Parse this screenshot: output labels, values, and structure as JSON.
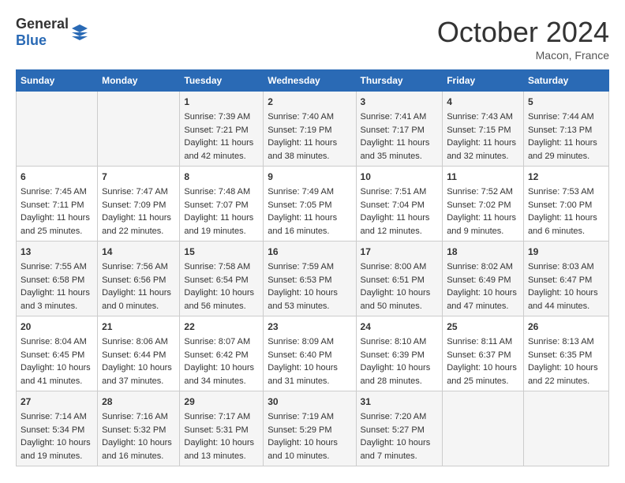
{
  "logo": {
    "general": "General",
    "blue": "Blue"
  },
  "title": "October 2024",
  "subtitle": "Macon, France",
  "headers": [
    "Sunday",
    "Monday",
    "Tuesday",
    "Wednesday",
    "Thursday",
    "Friday",
    "Saturday"
  ],
  "weeks": [
    [
      {
        "day": "",
        "sunrise": "",
        "sunset": "",
        "daylight": ""
      },
      {
        "day": "",
        "sunrise": "",
        "sunset": "",
        "daylight": ""
      },
      {
        "day": "1",
        "sunrise": "Sunrise: 7:39 AM",
        "sunset": "Sunset: 7:21 PM",
        "daylight": "Daylight: 11 hours and 42 minutes."
      },
      {
        "day": "2",
        "sunrise": "Sunrise: 7:40 AM",
        "sunset": "Sunset: 7:19 PM",
        "daylight": "Daylight: 11 hours and 38 minutes."
      },
      {
        "day": "3",
        "sunrise": "Sunrise: 7:41 AM",
        "sunset": "Sunset: 7:17 PM",
        "daylight": "Daylight: 11 hours and 35 minutes."
      },
      {
        "day": "4",
        "sunrise": "Sunrise: 7:43 AM",
        "sunset": "Sunset: 7:15 PM",
        "daylight": "Daylight: 11 hours and 32 minutes."
      },
      {
        "day": "5",
        "sunrise": "Sunrise: 7:44 AM",
        "sunset": "Sunset: 7:13 PM",
        "daylight": "Daylight: 11 hours and 29 minutes."
      }
    ],
    [
      {
        "day": "6",
        "sunrise": "Sunrise: 7:45 AM",
        "sunset": "Sunset: 7:11 PM",
        "daylight": "Daylight: 11 hours and 25 minutes."
      },
      {
        "day": "7",
        "sunrise": "Sunrise: 7:47 AM",
        "sunset": "Sunset: 7:09 PM",
        "daylight": "Daylight: 11 hours and 22 minutes."
      },
      {
        "day": "8",
        "sunrise": "Sunrise: 7:48 AM",
        "sunset": "Sunset: 7:07 PM",
        "daylight": "Daylight: 11 hours and 19 minutes."
      },
      {
        "day": "9",
        "sunrise": "Sunrise: 7:49 AM",
        "sunset": "Sunset: 7:05 PM",
        "daylight": "Daylight: 11 hours and 16 minutes."
      },
      {
        "day": "10",
        "sunrise": "Sunrise: 7:51 AM",
        "sunset": "Sunset: 7:04 PM",
        "daylight": "Daylight: 11 hours and 12 minutes."
      },
      {
        "day": "11",
        "sunrise": "Sunrise: 7:52 AM",
        "sunset": "Sunset: 7:02 PM",
        "daylight": "Daylight: 11 hours and 9 minutes."
      },
      {
        "day": "12",
        "sunrise": "Sunrise: 7:53 AM",
        "sunset": "Sunset: 7:00 PM",
        "daylight": "Daylight: 11 hours and 6 minutes."
      }
    ],
    [
      {
        "day": "13",
        "sunrise": "Sunrise: 7:55 AM",
        "sunset": "Sunset: 6:58 PM",
        "daylight": "Daylight: 11 hours and 3 minutes."
      },
      {
        "day": "14",
        "sunrise": "Sunrise: 7:56 AM",
        "sunset": "Sunset: 6:56 PM",
        "daylight": "Daylight: 11 hours and 0 minutes."
      },
      {
        "day": "15",
        "sunrise": "Sunrise: 7:58 AM",
        "sunset": "Sunset: 6:54 PM",
        "daylight": "Daylight: 10 hours and 56 minutes."
      },
      {
        "day": "16",
        "sunrise": "Sunrise: 7:59 AM",
        "sunset": "Sunset: 6:53 PM",
        "daylight": "Daylight: 10 hours and 53 minutes."
      },
      {
        "day": "17",
        "sunrise": "Sunrise: 8:00 AM",
        "sunset": "Sunset: 6:51 PM",
        "daylight": "Daylight: 10 hours and 50 minutes."
      },
      {
        "day": "18",
        "sunrise": "Sunrise: 8:02 AM",
        "sunset": "Sunset: 6:49 PM",
        "daylight": "Daylight: 10 hours and 47 minutes."
      },
      {
        "day": "19",
        "sunrise": "Sunrise: 8:03 AM",
        "sunset": "Sunset: 6:47 PM",
        "daylight": "Daylight: 10 hours and 44 minutes."
      }
    ],
    [
      {
        "day": "20",
        "sunrise": "Sunrise: 8:04 AM",
        "sunset": "Sunset: 6:45 PM",
        "daylight": "Daylight: 10 hours and 41 minutes."
      },
      {
        "day": "21",
        "sunrise": "Sunrise: 8:06 AM",
        "sunset": "Sunset: 6:44 PM",
        "daylight": "Daylight: 10 hours and 37 minutes."
      },
      {
        "day": "22",
        "sunrise": "Sunrise: 8:07 AM",
        "sunset": "Sunset: 6:42 PM",
        "daylight": "Daylight: 10 hours and 34 minutes."
      },
      {
        "day": "23",
        "sunrise": "Sunrise: 8:09 AM",
        "sunset": "Sunset: 6:40 PM",
        "daylight": "Daylight: 10 hours and 31 minutes."
      },
      {
        "day": "24",
        "sunrise": "Sunrise: 8:10 AM",
        "sunset": "Sunset: 6:39 PM",
        "daylight": "Daylight: 10 hours and 28 minutes."
      },
      {
        "day": "25",
        "sunrise": "Sunrise: 8:11 AM",
        "sunset": "Sunset: 6:37 PM",
        "daylight": "Daylight: 10 hours and 25 minutes."
      },
      {
        "day": "26",
        "sunrise": "Sunrise: 8:13 AM",
        "sunset": "Sunset: 6:35 PM",
        "daylight": "Daylight: 10 hours and 22 minutes."
      }
    ],
    [
      {
        "day": "27",
        "sunrise": "Sunrise: 7:14 AM",
        "sunset": "Sunset: 5:34 PM",
        "daylight": "Daylight: 10 hours and 19 minutes."
      },
      {
        "day": "28",
        "sunrise": "Sunrise: 7:16 AM",
        "sunset": "Sunset: 5:32 PM",
        "daylight": "Daylight: 10 hours and 16 minutes."
      },
      {
        "day": "29",
        "sunrise": "Sunrise: 7:17 AM",
        "sunset": "Sunset: 5:31 PM",
        "daylight": "Daylight: 10 hours and 13 minutes."
      },
      {
        "day": "30",
        "sunrise": "Sunrise: 7:19 AM",
        "sunset": "Sunset: 5:29 PM",
        "daylight": "Daylight: 10 hours and 10 minutes."
      },
      {
        "day": "31",
        "sunrise": "Sunrise: 7:20 AM",
        "sunset": "Sunset: 5:27 PM",
        "daylight": "Daylight: 10 hours and 7 minutes."
      },
      {
        "day": "",
        "sunrise": "",
        "sunset": "",
        "daylight": ""
      },
      {
        "day": "",
        "sunrise": "",
        "sunset": "",
        "daylight": ""
      }
    ]
  ]
}
